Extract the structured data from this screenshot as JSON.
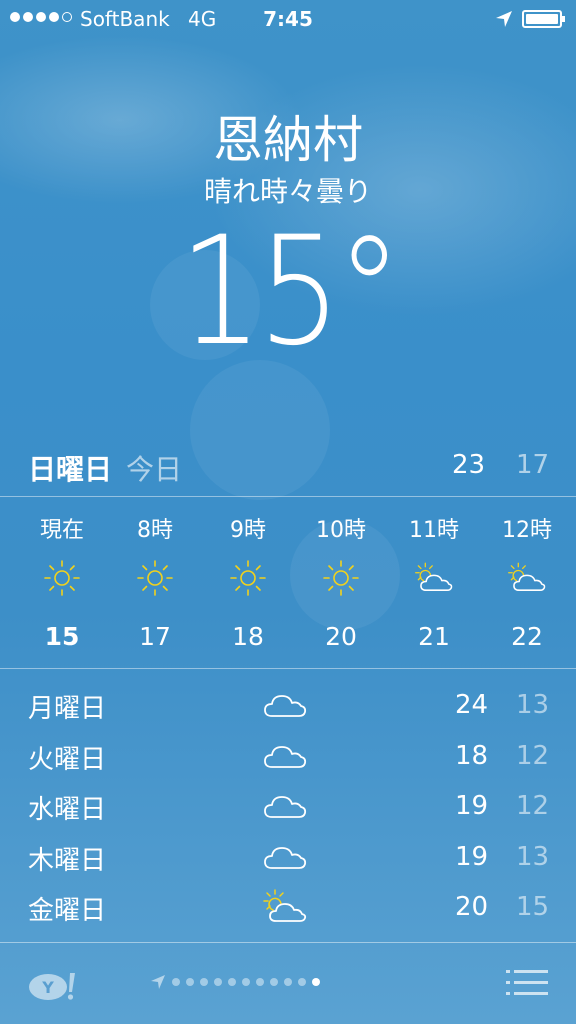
{
  "status_bar": {
    "carrier": "SoftBank",
    "network": "4G",
    "time": "7:45",
    "signal_bars": 4,
    "signal_total": 5,
    "battery_level": 1.0
  },
  "location": {
    "city": "恩納村",
    "condition": "晴れ時々曇り",
    "temperature": "15°"
  },
  "today": {
    "day": "日曜日",
    "label": "今日",
    "high": "23",
    "low": "17"
  },
  "hourly": [
    {
      "time": "現在",
      "icon": "sun-icon",
      "temp": "15"
    },
    {
      "time": "8時",
      "icon": "sun-icon",
      "temp": "17"
    },
    {
      "time": "9時",
      "icon": "sun-icon",
      "temp": "18"
    },
    {
      "time": "10時",
      "icon": "sun-icon",
      "temp": "20"
    },
    {
      "time": "11時",
      "icon": "partly-cloudy-icon",
      "temp": "21"
    },
    {
      "time": "12時",
      "icon": "partly-cloudy-icon",
      "temp": "22"
    }
  ],
  "daily": [
    {
      "day": "月曜日",
      "icon": "cloud-icon",
      "high": "24",
      "low": "13"
    },
    {
      "day": "火曜日",
      "icon": "cloud-icon",
      "high": "18",
      "low": "12"
    },
    {
      "day": "水曜日",
      "icon": "cloud-icon",
      "high": "19",
      "low": "12"
    },
    {
      "day": "木曜日",
      "icon": "cloud-icon",
      "high": "19",
      "low": "13"
    },
    {
      "day": "金曜日",
      "icon": "partly-cloudy-icon",
      "high": "20",
      "low": "15"
    }
  ],
  "toolbar": {
    "logo": "Y!",
    "page_count": 11,
    "active_page": 11
  },
  "colors": {
    "sun": "#f2d21b",
    "background": "#3d8fc8"
  }
}
